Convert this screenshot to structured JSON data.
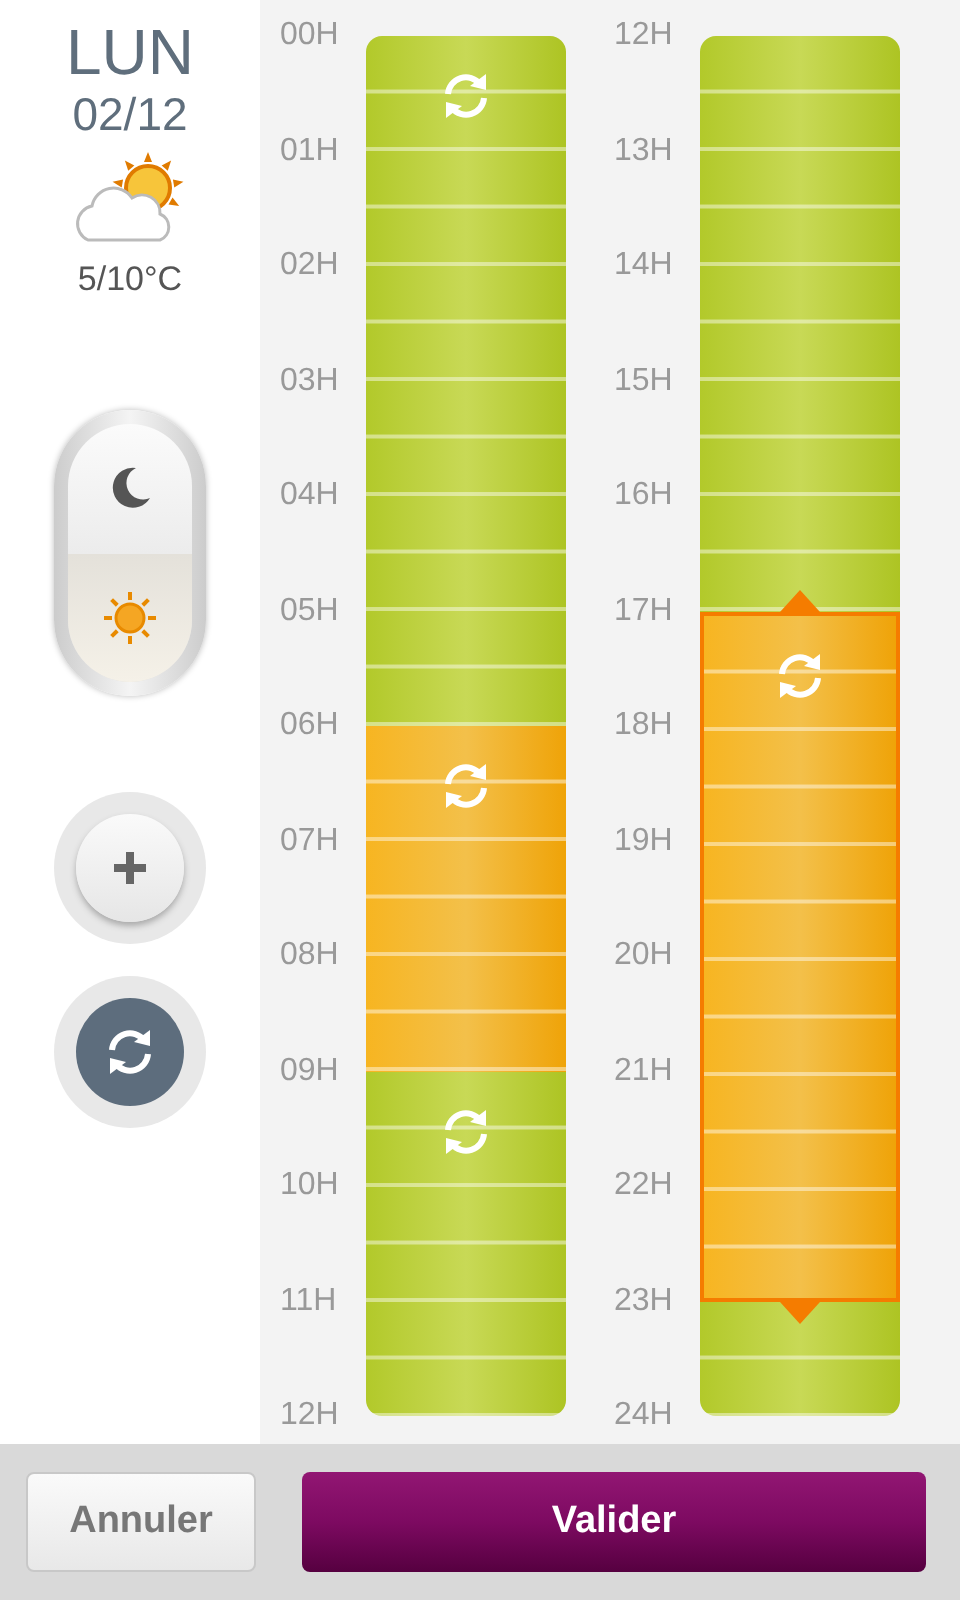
{
  "day": {
    "name": "LUN",
    "date": "02/12",
    "temperature": "5/10°C"
  },
  "mode_toggle": [
    {
      "kind": "moon",
      "selected": false
    },
    {
      "kind": "sun",
      "selected": true
    }
  ],
  "columns": [
    {
      "blocks": [
        {
          "hours": [
            "00H",
            "01H",
            "02H",
            "03H",
            "04H",
            "05H"
          ],
          "kind": "comfort",
          "cycle": true,
          "selected": false
        },
        {
          "hours": [
            "06H",
            "07H",
            "08H"
          ],
          "kind": "eco",
          "cycle": true,
          "selected": false
        },
        {
          "hours": [
            "09H",
            "10H",
            "11H"
          ],
          "kind": "comfort",
          "cycle": true,
          "selected": false
        }
      ],
      "end": "12H"
    },
    {
      "blocks": [
        {
          "hours": [
            "12H",
            "13H",
            "14H",
            "15H",
            "16H"
          ],
          "kind": "comfort",
          "cycle": false,
          "selected": false
        },
        {
          "hours": [
            "17H",
            "18H",
            "19H",
            "20H",
            "21H",
            "22H"
          ],
          "kind": "eco",
          "cycle": true,
          "selected": true
        },
        {
          "hours": [
            "23H"
          ],
          "kind": "comfort",
          "cycle": false,
          "selected": false
        }
      ],
      "end": "24H"
    }
  ],
  "buttons": {
    "cancel": "Annuler",
    "confirm": "Valider"
  }
}
